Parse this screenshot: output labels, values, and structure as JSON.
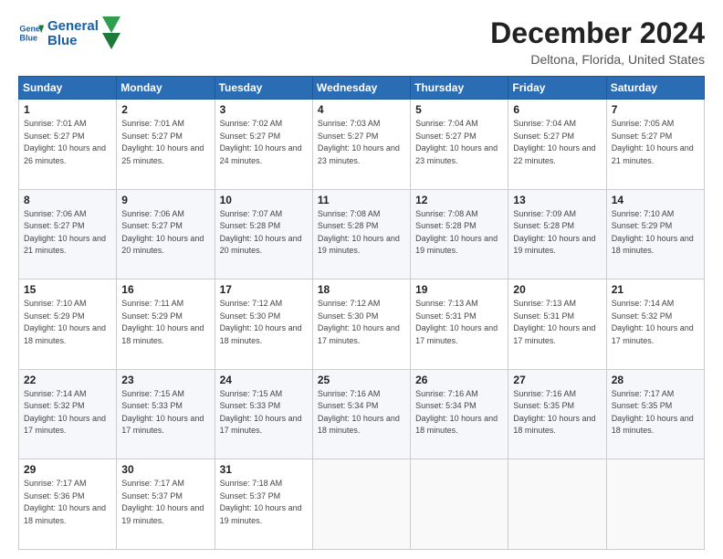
{
  "header": {
    "logo_general": "General",
    "logo_blue": "Blue",
    "month": "December 2024",
    "location": "Deltona, Florida, United States"
  },
  "weekdays": [
    "Sunday",
    "Monday",
    "Tuesday",
    "Wednesday",
    "Thursday",
    "Friday",
    "Saturday"
  ],
  "weeks": [
    [
      {
        "day": "1",
        "sunrise": "7:01 AM",
        "sunset": "5:27 PM",
        "daylight": "10 hours and 26 minutes."
      },
      {
        "day": "2",
        "sunrise": "7:01 AM",
        "sunset": "5:27 PM",
        "daylight": "10 hours and 25 minutes."
      },
      {
        "day": "3",
        "sunrise": "7:02 AM",
        "sunset": "5:27 PM",
        "daylight": "10 hours and 24 minutes."
      },
      {
        "day": "4",
        "sunrise": "7:03 AM",
        "sunset": "5:27 PM",
        "daylight": "10 hours and 23 minutes."
      },
      {
        "day": "5",
        "sunrise": "7:04 AM",
        "sunset": "5:27 PM",
        "daylight": "10 hours and 23 minutes."
      },
      {
        "day": "6",
        "sunrise": "7:04 AM",
        "sunset": "5:27 PM",
        "daylight": "10 hours and 22 minutes."
      },
      {
        "day": "7",
        "sunrise": "7:05 AM",
        "sunset": "5:27 PM",
        "daylight": "10 hours and 21 minutes."
      }
    ],
    [
      {
        "day": "8",
        "sunrise": "7:06 AM",
        "sunset": "5:27 PM",
        "daylight": "10 hours and 21 minutes."
      },
      {
        "day": "9",
        "sunrise": "7:06 AM",
        "sunset": "5:27 PM",
        "daylight": "10 hours and 20 minutes."
      },
      {
        "day": "10",
        "sunrise": "7:07 AM",
        "sunset": "5:28 PM",
        "daylight": "10 hours and 20 minutes."
      },
      {
        "day": "11",
        "sunrise": "7:08 AM",
        "sunset": "5:28 PM",
        "daylight": "10 hours and 19 minutes."
      },
      {
        "day": "12",
        "sunrise": "7:08 AM",
        "sunset": "5:28 PM",
        "daylight": "10 hours and 19 minutes."
      },
      {
        "day": "13",
        "sunrise": "7:09 AM",
        "sunset": "5:28 PM",
        "daylight": "10 hours and 19 minutes."
      },
      {
        "day": "14",
        "sunrise": "7:10 AM",
        "sunset": "5:29 PM",
        "daylight": "10 hours and 18 minutes."
      }
    ],
    [
      {
        "day": "15",
        "sunrise": "7:10 AM",
        "sunset": "5:29 PM",
        "daylight": "10 hours and 18 minutes."
      },
      {
        "day": "16",
        "sunrise": "7:11 AM",
        "sunset": "5:29 PM",
        "daylight": "10 hours and 18 minutes."
      },
      {
        "day": "17",
        "sunrise": "7:12 AM",
        "sunset": "5:30 PM",
        "daylight": "10 hours and 18 minutes."
      },
      {
        "day": "18",
        "sunrise": "7:12 AM",
        "sunset": "5:30 PM",
        "daylight": "10 hours and 17 minutes."
      },
      {
        "day": "19",
        "sunrise": "7:13 AM",
        "sunset": "5:31 PM",
        "daylight": "10 hours and 17 minutes."
      },
      {
        "day": "20",
        "sunrise": "7:13 AM",
        "sunset": "5:31 PM",
        "daylight": "10 hours and 17 minutes."
      },
      {
        "day": "21",
        "sunrise": "7:14 AM",
        "sunset": "5:32 PM",
        "daylight": "10 hours and 17 minutes."
      }
    ],
    [
      {
        "day": "22",
        "sunrise": "7:14 AM",
        "sunset": "5:32 PM",
        "daylight": "10 hours and 17 minutes."
      },
      {
        "day": "23",
        "sunrise": "7:15 AM",
        "sunset": "5:33 PM",
        "daylight": "10 hours and 17 minutes."
      },
      {
        "day": "24",
        "sunrise": "7:15 AM",
        "sunset": "5:33 PM",
        "daylight": "10 hours and 17 minutes."
      },
      {
        "day": "25",
        "sunrise": "7:16 AM",
        "sunset": "5:34 PM",
        "daylight": "10 hours and 18 minutes."
      },
      {
        "day": "26",
        "sunrise": "7:16 AM",
        "sunset": "5:34 PM",
        "daylight": "10 hours and 18 minutes."
      },
      {
        "day": "27",
        "sunrise": "7:16 AM",
        "sunset": "5:35 PM",
        "daylight": "10 hours and 18 minutes."
      },
      {
        "day": "28",
        "sunrise": "7:17 AM",
        "sunset": "5:35 PM",
        "daylight": "10 hours and 18 minutes."
      }
    ],
    [
      {
        "day": "29",
        "sunrise": "7:17 AM",
        "sunset": "5:36 PM",
        "daylight": "10 hours and 18 minutes."
      },
      {
        "day": "30",
        "sunrise": "7:17 AM",
        "sunset": "5:37 PM",
        "daylight": "10 hours and 19 minutes."
      },
      {
        "day": "31",
        "sunrise": "7:18 AM",
        "sunset": "5:37 PM",
        "daylight": "10 hours and 19 minutes."
      },
      null,
      null,
      null,
      null
    ]
  ]
}
